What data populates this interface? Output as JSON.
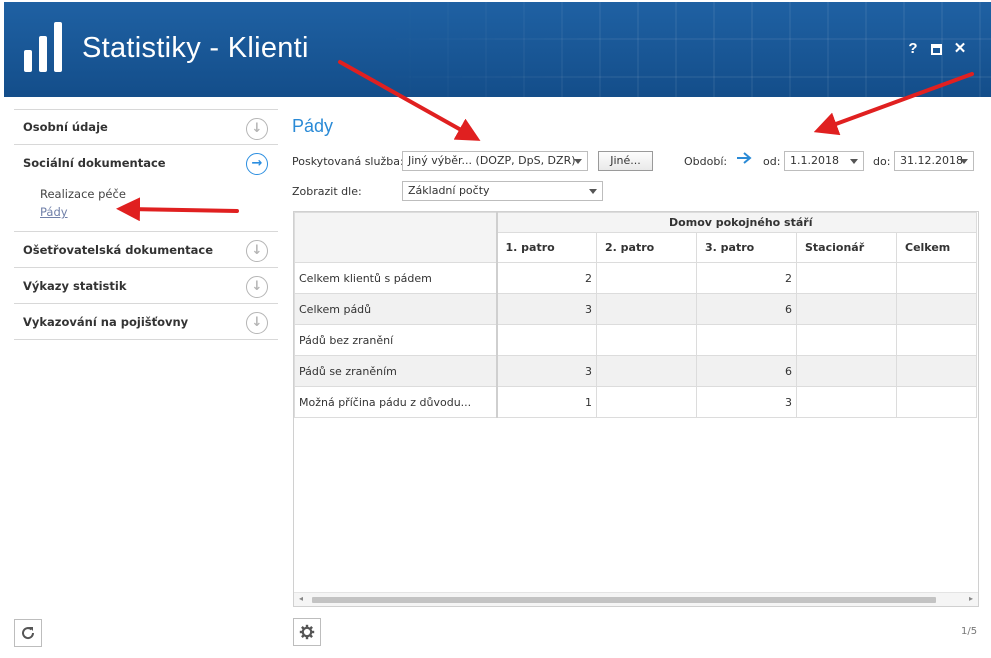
{
  "window": {
    "title": "Statistiky - Klienti",
    "controls": {
      "help": "?",
      "close": "✕"
    }
  },
  "sidebar": {
    "items": [
      {
        "label": "Osobní údaje"
      },
      {
        "label": "Sociální dokumentace",
        "expanded": true,
        "children": [
          {
            "label": "Realizace péče"
          },
          {
            "label": "Pády",
            "active": true
          }
        ]
      },
      {
        "label": "Ošetřovatelská dokumentace"
      },
      {
        "label": "Výkazy statistik"
      },
      {
        "label": "Vykazování na pojišťovny"
      }
    ]
  },
  "main": {
    "title": "Pády",
    "filters": {
      "service_label": "Poskytovaná služba:",
      "service_value": "Jiný výběr... (DOZP, DpS, DZR)",
      "other_button": "Jiné...",
      "period_label": "Období:",
      "from_label": "od:",
      "from_value": "1.1.2018",
      "to_label": "do:",
      "to_value": "31.12.2018",
      "display_label": "Zobrazit dle:",
      "display_value": "Základní počty"
    },
    "table": {
      "group_header": "Domov pokojného stáří",
      "columns": [
        "1. patro",
        "2. patro",
        "3. patro",
        "Stacionář",
        "Celkem"
      ],
      "rows": [
        {
          "label": "Celkem klientů s pádem",
          "cells": [
            "2",
            "",
            "2",
            "",
            ""
          ]
        },
        {
          "label": "Celkem pádů",
          "cells": [
            "3",
            "",
            "6",
            "",
            ""
          ]
        },
        {
          "label": "Pádů bez zranění",
          "cells": [
            "",
            "",
            "",
            "",
            ""
          ]
        },
        {
          "label": "Pádů se zraněním",
          "cells": [
            "3",
            "",
            "6",
            "",
            ""
          ]
        },
        {
          "label": "Možná příčina pádu z důvodu...",
          "cells": [
            "1",
            "",
            "3",
            "",
            ""
          ]
        }
      ]
    },
    "pager": "1/5"
  },
  "icons": {
    "logo": "bar-chart-logo",
    "nav_collapsed": "arrow-down-circle-icon",
    "nav_expanded": "arrow-right-circle-icon",
    "refresh": "refresh-icon",
    "settings": "gear-icon",
    "period": "arrow-right-icon"
  },
  "colors": {
    "header": "#1a5a9a",
    "accent": "#2a8ad6",
    "annotation": "#e02020"
  }
}
